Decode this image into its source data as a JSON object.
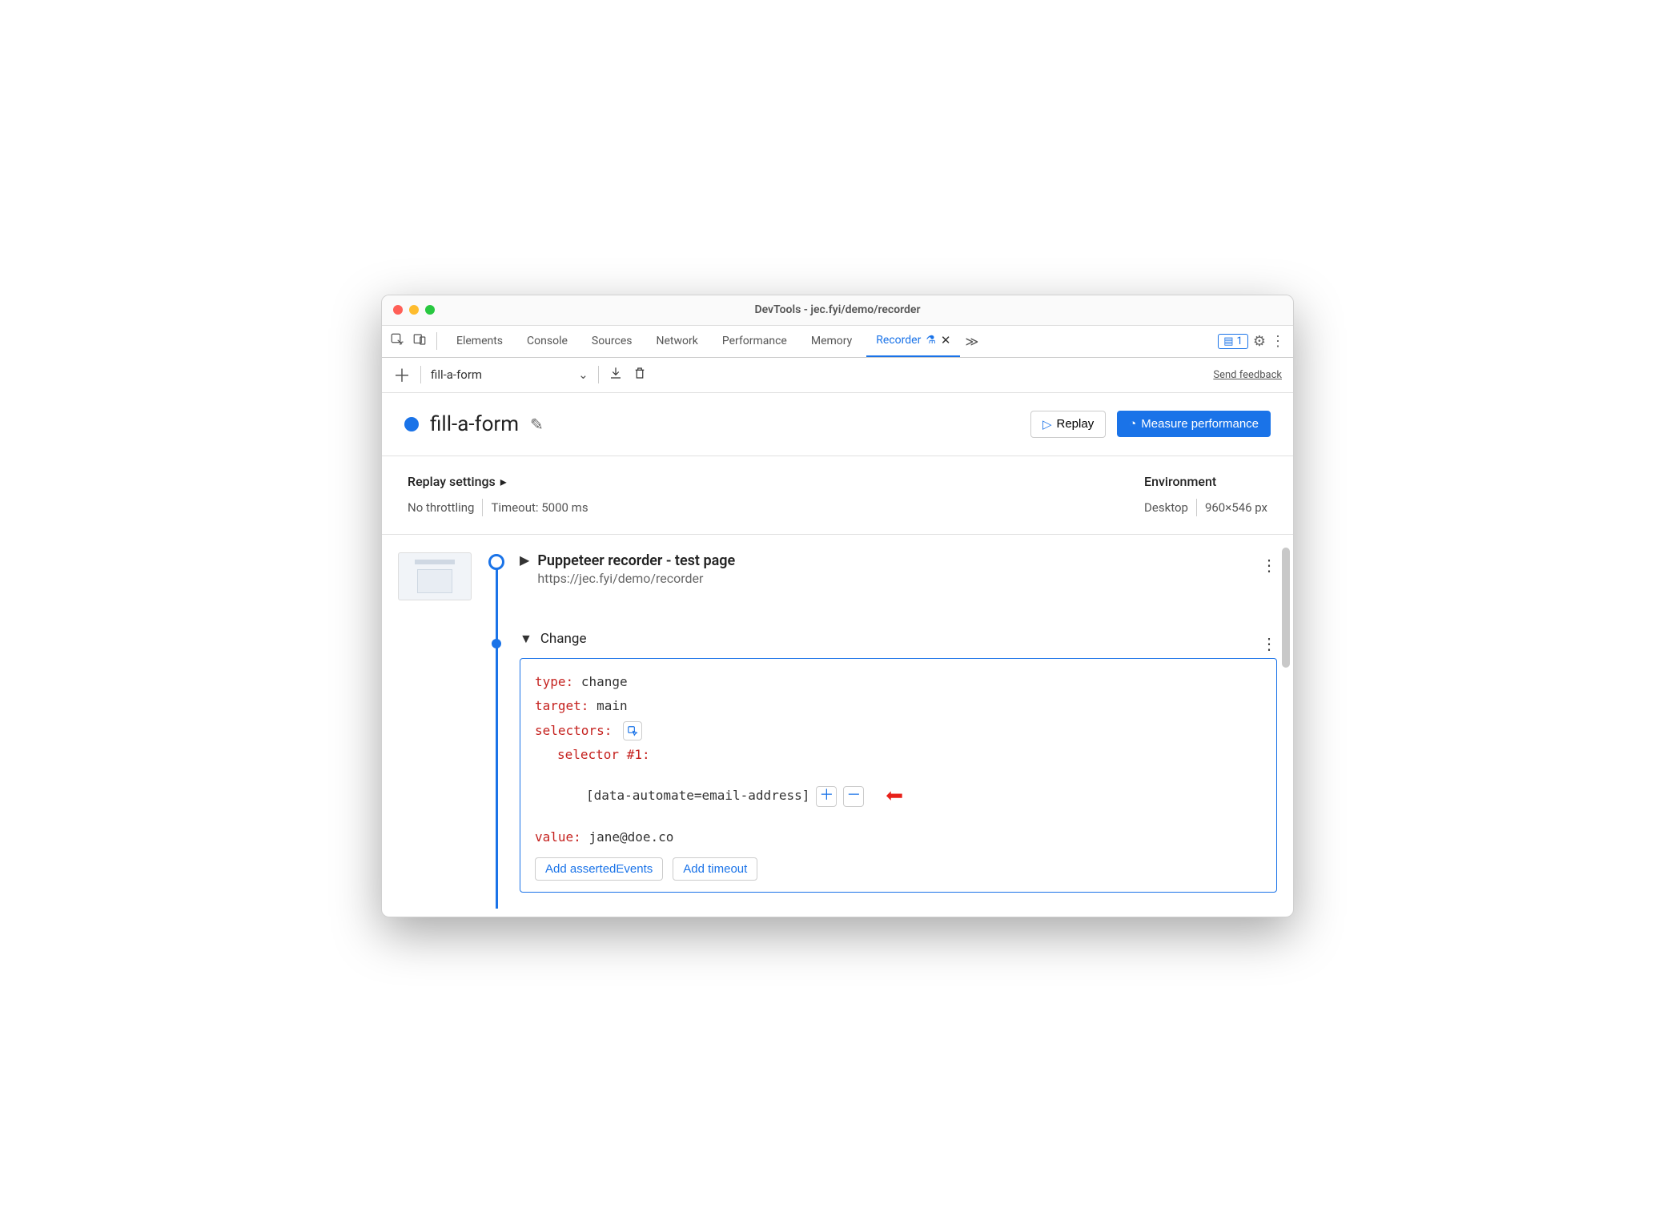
{
  "window": {
    "title": "DevTools - jec.fyi/demo/recorder"
  },
  "tabs": {
    "items": [
      "Elements",
      "Console",
      "Sources",
      "Network",
      "Performance",
      "Memory",
      "Recorder"
    ],
    "active": "Recorder",
    "badge_count": "1"
  },
  "subbar": {
    "recording_name": "fill-a-form",
    "feedback": "Send feedback"
  },
  "header": {
    "title": "fill-a-form",
    "replay_label": "Replay",
    "measure_label": "Measure performance"
  },
  "settings": {
    "replay_title": "Replay settings",
    "throttling": "No throttling",
    "timeout": "Timeout: 5000 ms",
    "env_title": "Environment",
    "device": "Desktop",
    "viewport": "960×546 px"
  },
  "steps": {
    "s1": {
      "title": "Puppeteer recorder - test page",
      "url": "https://jec.fyi/demo/recorder"
    },
    "s2": {
      "title": "Change",
      "type_k": "type",
      "type_v": "change",
      "target_k": "target",
      "target_v": "main",
      "selectors_k": "selectors",
      "selector_label": "selector #1",
      "selector_value": "[data-automate=email-address]",
      "value_k": "value",
      "value_v": "jane@doe.co",
      "add_asserted": "Add assertedEvents",
      "add_timeout": "Add timeout"
    }
  }
}
